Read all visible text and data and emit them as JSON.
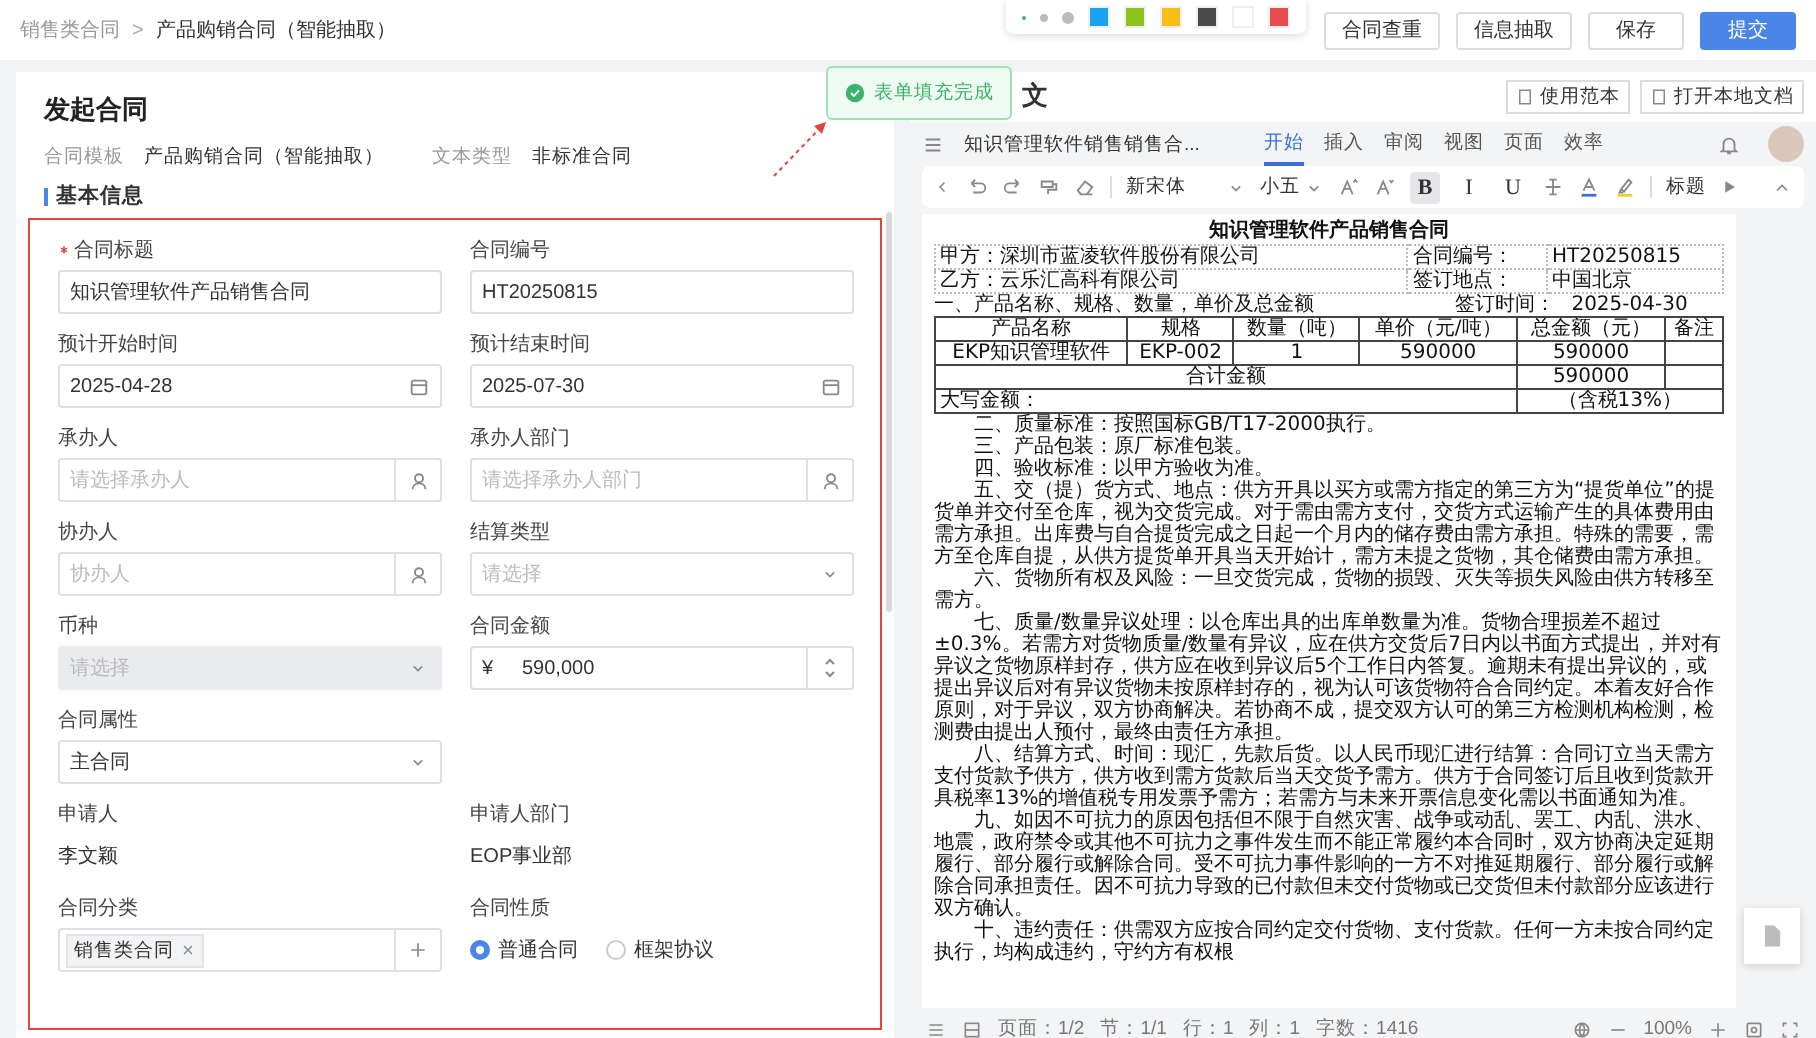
{
  "breadcrumb": {
    "items": [
      "销售类合同",
      "产品购销合同（智能抽取）"
    ],
    "separator": ">"
  },
  "palette": {
    "colors": [
      {
        "color": "#1aa1f0"
      },
      {
        "color": "#8cc21a"
      },
      {
        "color": "#f7bf16"
      },
      {
        "color": "#4a4a4a"
      },
      {
        "color": "#ffffff"
      },
      {
        "color": "#e84c4c"
      }
    ]
  },
  "actions": [
    {
      "label": "合同查重",
      "kind": "default"
    },
    {
      "label": "信息抽取",
      "kind": "default"
    },
    {
      "label": "保存",
      "kind": "default"
    },
    {
      "label": "提交",
      "kind": "primary"
    }
  ],
  "toast": {
    "text": "表单填充完成"
  },
  "form": {
    "title": "发起合同",
    "meta": [
      {
        "label": "合同模板",
        "value": "产品购销合同（智能抽取）"
      },
      {
        "label": "文本类型",
        "value": "非标准合同"
      }
    ],
    "section": "基本信息",
    "rows": [
      [
        {
          "label": "合同标题",
          "required": true,
          "kind": "text",
          "value": "知识管理软件产品销售合同",
          "disabled": false
        },
        {
          "label": "合同编号",
          "required": false,
          "kind": "text",
          "value": "HT20250815",
          "disabled": false
        }
      ],
      [
        {
          "label": "预计开始时间",
          "required": false,
          "kind": "date",
          "value": "2025-04-28",
          "disabled": false
        },
        {
          "label": "预计结束时间",
          "required": false,
          "kind": "date",
          "value": "2025-07-30",
          "disabled": false
        }
      ],
      [
        {
          "label": "承办人",
          "required": false,
          "kind": "picker",
          "placeholder": "请选择承办人",
          "disabled": false
        },
        {
          "label": "承办人部门",
          "required": false,
          "kind": "picker",
          "placeholder": "请选择承办人部门",
          "disabled": false
        }
      ],
      [
        {
          "label": "协办人",
          "required": false,
          "kind": "picker",
          "placeholder": "协办人",
          "disabled": false
        },
        {
          "label": "结算类型",
          "required": false,
          "kind": "select",
          "placeholder": "请选择",
          "disabled": false
        }
      ],
      [
        {
          "label": "币种",
          "required": false,
          "kind": "select",
          "placeholder": "请选择",
          "disabled": true
        },
        {
          "label": "合同金额",
          "required": false,
          "kind": "money",
          "prefix": "¥",
          "value": "590,000",
          "disabled": false
        }
      ],
      [
        {
          "label": "合同属性",
          "required": false,
          "kind": "select",
          "value": "主合同",
          "disabled": false
        }
      ],
      [
        {
          "label": "申请人",
          "required": false,
          "kind": "static",
          "value": "李文颖"
        },
        {
          "label": "申请人部门",
          "required": false,
          "kind": "static",
          "value": "EOP事业部"
        }
      ],
      [
        {
          "label": "合同分类",
          "required": false,
          "kind": "tags",
          "tags": [
            "销售类合同"
          ],
          "disabled": false
        },
        {
          "label": "合同性质",
          "required": false,
          "kind": "radio",
          "options": [
            {
              "label": "普通合同",
              "selected": true
            },
            {
              "label": "框架协议",
              "selected": false
            }
          ]
        }
      ]
    ]
  },
  "editor": {
    "heading": "文",
    "tools": [
      "使用范本",
      "打开本地文档"
    ],
    "doc_title": "知识管理软件销售销售合...",
    "tabs": [
      {
        "label": "开始",
        "selected": true
      },
      {
        "label": "插入",
        "selected": false
      },
      {
        "label": "审阅",
        "selected": false
      },
      {
        "label": "视图",
        "selected": false
      },
      {
        "label": "页面",
        "selected": false
      },
      {
        "label": "效率",
        "selected": false
      }
    ],
    "font": "新宋体",
    "size": "小五",
    "marks": [
      {
        "glyph": "B",
        "selected": true
      },
      {
        "glyph": "I",
        "selected": false
      },
      {
        "glyph": "U",
        "selected": false
      }
    ],
    "style": "标题",
    "document": {
      "title": "知识管理软件产品销售合同",
      "header_rows": [
        [
          "甲方：深圳市蓝凌软件股份有限公司",
          "合同编号：",
          "HT20250815"
        ],
        [
          "乙方：云乐汇高科有限公司",
          "签订地点：",
          "中国北京"
        ]
      ],
      "section": "一、产品名称、规格、数量，单价及总金额",
      "sign_label": "签订时间：",
      "sign_date": "2025-04-30",
      "columns": [
        "产品名称",
        "规格",
        "数量（吨）",
        "单价（元/吨）",
        "总金额（元）",
        "备注"
      ],
      "rows": [
        [
          "EKP知识管理软件",
          "EKP-002",
          "1",
          "590000",
          "590000",
          ""
        ]
      ],
      "total_label": "合计金额",
      "total": "590000",
      "words_label": "大写金额：",
      "tax": "（含税13%）",
      "paragraphs": [
        "二、质量标准：按照国标GB/T17-2000执行。",
        "三、产品包装：原厂标准包装。",
        "四、验收标准：以甲方验收为准。",
        "五、交（提）货方式、地点：供方开具以买方或需方指定的第三方为“提货单位”的提货单并交付至仓库，视为交货完成。对于需由需方支付，交货方式运输产生的具体费用由需方承担。出库费与自合提货完成之日起一个月内的储存费由需方承担。特殊的需要，需方至仓库自提，从供方提货单开具当天开始计，需方未提之货物，其仓储费由需方承担。",
        "六、货物所有权及风险：一旦交货完成，货物的损毁、灭失等损失风险由供方转移至需方。",
        "七、质量/数量异议处理：以仓库出具的出库单数量为准。货物合理损差不超过±0.3%。若需方对货物质量/数量有异议，应在供方交货后7日内以书面方式提出，并对有异议之货物原样封存，供方应在收到异议后5个工作日内答复。逾期未有提出异议的，或提出异议后对有异议货物未按原样封存的，视为认可该货物符合合同约定。本着友好合作原则，对于异议，双方协商解决。若协商不成，提交双方认可的第三方检测机构检测，检测费由提出人预付，最终由责任方承担。",
        "八、结算方式、时间：现汇，先款后货。以人民币现汇进行结算：合同订立当天需方支付货款予供方，供方收到需方货款后当天交货予需方。供方于合同签订后且收到货款开具税率13%的增值税专用发票予需方；若需方与未来开票信息变化需以书面通知为准。",
        "九、如因不可抗力的原因包括但不限于自然灾害、战争或动乱、罢工、内乱、洪水、地震，政府禁令或其他不可抗力之事件发生而不能正常履约本合同时，双方协商决定延期履行、部分履行或解除合同。受不可抗力事件影响的一方不对推延期履行、部分履行或解除合同承担责任。因不可抗力导致的已付款但未交付货物或已交货但未付款部分应该进行双方确认。",
        "十、违约责任：供需双方应按合同约定交付货物、支付货款。任何一方未按合同约定执行，均构成违约，守约方有权根"
      ]
    },
    "status": [
      "页面：1/2",
      "节：1/1",
      "行：1",
      "列：1",
      "字数：1416"
    ],
    "zoom": "100%"
  }
}
